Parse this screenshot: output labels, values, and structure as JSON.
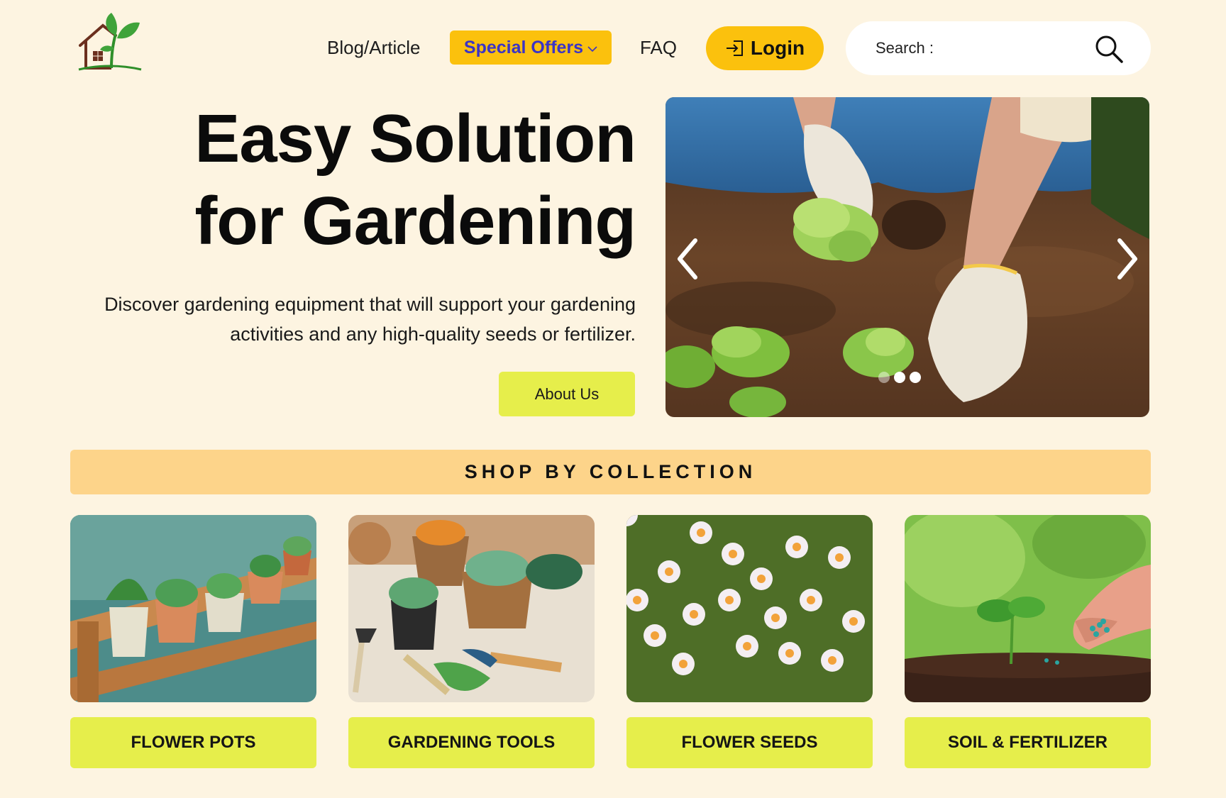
{
  "nav": {
    "blog": "Blog/Article",
    "special_offers": "Special Offers",
    "faq": "FAQ",
    "login": "Login"
  },
  "search": {
    "placeholder": "Search :"
  },
  "hero": {
    "title_line1": "Easy Solution",
    "title_line2": "for Gardening",
    "description": "Discover gardening equipment that will support your gardening activities and any high-quality seeds or fertilizer.",
    "about_button": "About Us",
    "carousel": {
      "slide_count": 3,
      "active_slide": 2
    }
  },
  "collection": {
    "heading": "SHOP BY COLLECTION",
    "items": [
      {
        "label": "FLOWER POTS"
      },
      {
        "label": "GARDENING TOOLS"
      },
      {
        "label": "FLOWER SEEDS"
      },
      {
        "label": "SOIL & FERTILIZER"
      }
    ]
  },
  "colors": {
    "background": "#fdf4e1",
    "accent_yellow": "#fbc10d",
    "lime": "#e6ee4b",
    "collection_bar": "#fdd48a",
    "offers_text": "#3b34c6"
  }
}
